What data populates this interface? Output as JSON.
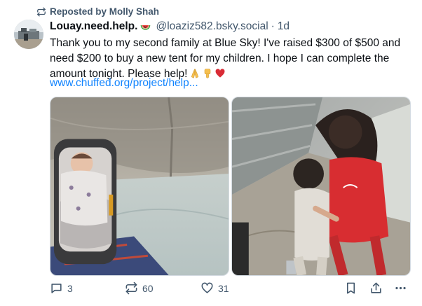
{
  "repost": {
    "label": "Reposted by Molly Shah",
    "icon": "repost-icon"
  },
  "author": {
    "display_name": "Louay.need.help.",
    "name_emoji": "watermelon-emoji",
    "handle": "@loaziz582.bsky.social",
    "separator": "·",
    "time": "1d"
  },
  "post": {
    "text": "Thank you to my second family at Blue Sky! I've raised $300 of $500 and need $200 to buy a new tent for my children. I hope I can complete the amount tonight. Please help!",
    "emojis": [
      "folded-hands-emoji",
      "pointing-down-emoji",
      "heart-exclamation-emoji"
    ],
    "link_text": "www.chuffed.org/project/help..."
  },
  "images": [
    {
      "name": "baby-in-tent-photo"
    },
    {
      "name": "children-in-tent-photo"
    }
  ],
  "actions": {
    "reply_count": "3",
    "repost_count": "60",
    "like_count": "31"
  },
  "colors": {
    "text": "#0b0f14",
    "muted": "#42576c",
    "link": "#1083fe"
  }
}
